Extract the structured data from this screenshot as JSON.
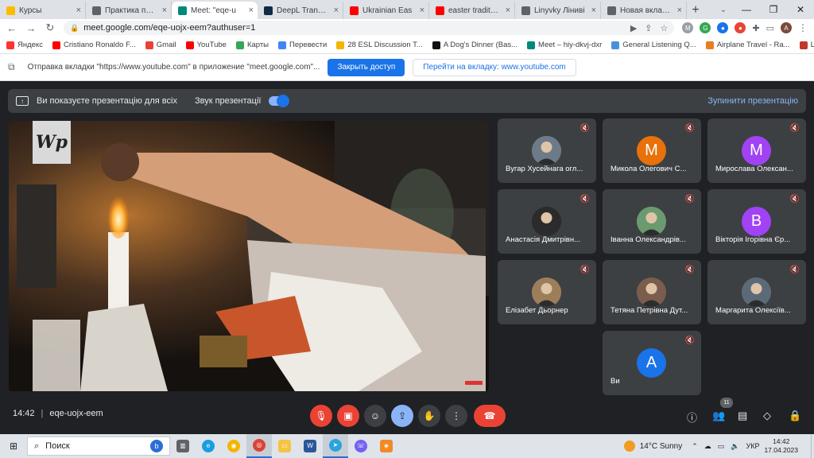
{
  "tabs": [
    {
      "title": "Курсы",
      "color": "#fbbc04",
      "active": false
    },
    {
      "title": "Практика перекл",
      "color": "#5f6368",
      "active": false
    },
    {
      "title": "Meet: \"eqe-u",
      "color": "#00897b",
      "active": true
    },
    {
      "title": "DeepL Translate –",
      "color": "#0f2b46",
      "active": false
    },
    {
      "title": "Ukrainian Eas",
      "color": "#ff0000",
      "active": false
    },
    {
      "title": "easter traditions",
      "color": "#ff0000",
      "active": false
    },
    {
      "title": "Linyvky Ліниві",
      "color": "#5f6368",
      "active": false
    },
    {
      "title": "Новая вкладка",
      "color": "#5f6368",
      "active": false
    }
  ],
  "address": {
    "url": "meet.google.com/eqe-uojx-eem?authuser=1"
  },
  "bookmarks": [
    {
      "label": "Яндекс",
      "color": "#ff3333"
    },
    {
      "label": "Cristiano Ronaldo F...",
      "color": "#ff0000"
    },
    {
      "label": "Gmail",
      "color": "#ea4335"
    },
    {
      "label": "YouTube",
      "color": "#ff0000"
    },
    {
      "label": "Карты",
      "color": "#34a853"
    },
    {
      "label": "Перевести",
      "color": "#4285f4"
    },
    {
      "label": "28 ESL Discussion T...",
      "color": "#f4b400"
    },
    {
      "label": "A Dog's Dinner (Bas...",
      "color": "#111111"
    },
    {
      "label": "Meet – hiy-dkvj-dxr",
      "color": "#00897b"
    },
    {
      "label": "General Listening Q...",
      "color": "#4a90d9"
    },
    {
      "label": "Airplane Travel - Ra...",
      "color": "#e67e22"
    },
    {
      "label": "LearnEnglish Kids li...",
      "color": "#c0392b"
    }
  ],
  "infobar": {
    "message": "Отправка вкладки \"https://www.youtube.com\" в приложение \"meet.google.com\"...",
    "close_access": "Закрыть доступ",
    "go_to_tab": "Перейти на вкладку: www.youtube.com"
  },
  "presentation_bar": {
    "text": "Ви показуєте презентацію для всіх",
    "sound": "Звук презентації",
    "stop": "Зупинити презентацію"
  },
  "participants": [
    {
      "name": "Вугар Хусейнага огл...",
      "initial": "",
      "color": "#6d7b88",
      "photo": true
    },
    {
      "name": "Микола Олегович С...",
      "initial": "M",
      "color": "#e8710a",
      "photo": false
    },
    {
      "name": "Мирослава Олексан...",
      "initial": "M",
      "color": "#a142f4",
      "photo": false
    },
    {
      "name": "Анастасія Дмитрівн...",
      "initial": "",
      "color": "#2b2b2b",
      "photo": true
    },
    {
      "name": "Іванна Олександрів...",
      "initial": "",
      "color": "#6b9a6f",
      "photo": true
    },
    {
      "name": "Вікторія Ігорівна Єр...",
      "initial": "B",
      "color": "#a142f4",
      "photo": false
    },
    {
      "name": "Елізабет Дьорнер",
      "initial": "",
      "color": "#9d7e5a",
      "photo": true
    },
    {
      "name": "Тетяна Петрівна Дут...",
      "initial": "",
      "color": "#7a5d4c",
      "photo": true
    },
    {
      "name": "Маргарита Олексіїв...",
      "initial": "",
      "color": "#5c6a78",
      "photo": true
    },
    {
      "name": "Ви",
      "initial": "A",
      "color": "#1a73e8",
      "photo": false
    }
  ],
  "meeting": {
    "time": "14:42",
    "code": "eqe-uojx-eem",
    "participant_count": "11"
  },
  "taskbar": {
    "search": "Поиск",
    "weather": "14°C Sunny",
    "lang": "УКР",
    "time": "14:42",
    "date": "17.04.2023"
  }
}
